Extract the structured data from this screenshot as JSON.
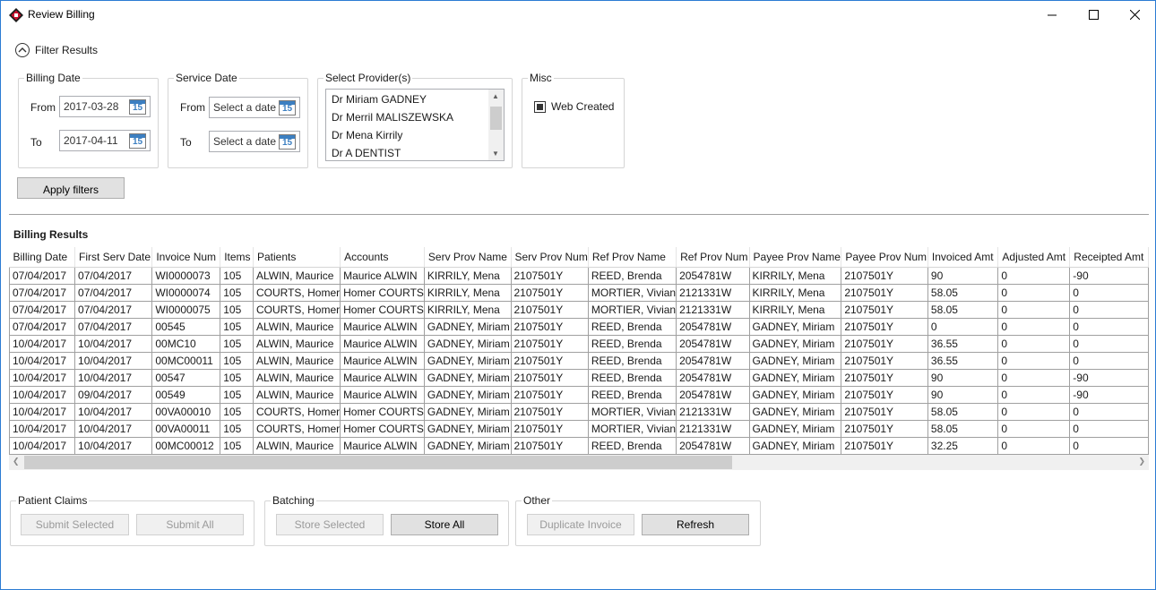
{
  "window": {
    "title": "Review Billing"
  },
  "filter": {
    "toggle_label": "Filter Results",
    "billing_date": {
      "legend": "Billing Date",
      "from_label": "From",
      "from_value": "2017-03-28",
      "to_label": "To",
      "to_value": "2017-04-11"
    },
    "service_date": {
      "legend": "Service Date",
      "from_label": "From",
      "from_placeholder": "Select a date",
      "to_label": "To",
      "to_placeholder": "Select a date"
    },
    "providers": {
      "legend": "Select Provider(s)",
      "items": [
        "Dr Miriam GADNEY",
        "Dr Merril MALISZEWSKA",
        "Dr Mena Kirrily",
        "Dr A DENTIST"
      ]
    },
    "misc": {
      "legend": "Misc",
      "web_created_label": "Web Created",
      "web_created_state": "indeterminate"
    },
    "apply_label": "Apply filters",
    "calendar_icon_text": "15"
  },
  "results": {
    "title": "Billing Results",
    "columns": [
      "Billing Date",
      "First Serv Date",
      "Invoice Num",
      "Items",
      "Patients",
      "Accounts",
      "Serv Prov Name",
      "Serv Prov Num",
      "Ref Prov Name",
      "Ref Prov Num",
      "Payee Prov Name",
      "Payee Prov Num",
      "Invoiced Amt",
      "Adjusted Amt",
      "Receipted Amt"
    ],
    "rows": [
      [
        "07/04/2017",
        "07/04/2017",
        "WI0000073",
        "105",
        "ALWIN, Maurice",
        "Maurice ALWIN",
        "KIRRILY, Mena",
        "2107501Y",
        "REED, Brenda",
        "2054781W",
        "KIRRILY, Mena",
        "2107501Y",
        "90",
        "0",
        "-90"
      ],
      [
        "07/04/2017",
        "07/04/2017",
        "WI0000074",
        "105",
        "COURTS, Homer",
        "Homer COURTS",
        "KIRRILY, Mena",
        "2107501Y",
        "MORTIER, Vivian",
        "2121331W",
        "KIRRILY, Mena",
        "2107501Y",
        "58.05",
        "0",
        "0"
      ],
      [
        "07/04/2017",
        "07/04/2017",
        "WI0000075",
        "105",
        "COURTS, Homer",
        "Homer COURTS",
        "KIRRILY, Mena",
        "2107501Y",
        "MORTIER, Vivian",
        "2121331W",
        "KIRRILY, Mena",
        "2107501Y",
        "58.05",
        "0",
        "0"
      ],
      [
        "07/04/2017",
        "07/04/2017",
        "00545",
        "105",
        "ALWIN, Maurice",
        "Maurice ALWIN",
        "GADNEY, Miriam",
        "2107501Y",
        "REED, Brenda",
        "2054781W",
        "GADNEY, Miriam",
        "2107501Y",
        "0",
        "0",
        "0"
      ],
      [
        "10/04/2017",
        "10/04/2017",
        "00MC10",
        "105",
        "ALWIN, Maurice",
        "Maurice ALWIN",
        "GADNEY, Miriam",
        "2107501Y",
        "REED, Brenda",
        "2054781W",
        "GADNEY, Miriam",
        "2107501Y",
        "36.55",
        "0",
        "0"
      ],
      [
        "10/04/2017",
        "10/04/2017",
        "00MC00011",
        "105",
        "ALWIN, Maurice",
        "Maurice ALWIN",
        "GADNEY, Miriam",
        "2107501Y",
        "REED, Brenda",
        "2054781W",
        "GADNEY, Miriam",
        "2107501Y",
        "36.55",
        "0",
        "0"
      ],
      [
        "10/04/2017",
        "10/04/2017",
        "00547",
        "105",
        "ALWIN, Maurice",
        "Maurice ALWIN",
        "GADNEY, Miriam",
        "2107501Y",
        "REED, Brenda",
        "2054781W",
        "GADNEY, Miriam",
        "2107501Y",
        "90",
        "0",
        "-90"
      ],
      [
        "10/04/2017",
        "09/04/2017",
        "00549",
        "105",
        "ALWIN, Maurice",
        "Maurice ALWIN",
        "GADNEY, Miriam",
        "2107501Y",
        "REED, Brenda",
        "2054781W",
        "GADNEY, Miriam",
        "2107501Y",
        "90",
        "0",
        "-90"
      ],
      [
        "10/04/2017",
        "10/04/2017",
        "00VA00010",
        "105",
        "COURTS, Homer",
        "Homer COURTS",
        "GADNEY, Miriam",
        "2107501Y",
        "MORTIER, Vivian",
        "2121331W",
        "GADNEY, Miriam",
        "2107501Y",
        "58.05",
        "0",
        "0"
      ],
      [
        "10/04/2017",
        "10/04/2017",
        "00VA00011",
        "105",
        "COURTS, Homer",
        "Homer COURTS",
        "GADNEY, Miriam",
        "2107501Y",
        "MORTIER, Vivian",
        "2121331W",
        "GADNEY, Miriam",
        "2107501Y",
        "58.05",
        "0",
        "0"
      ],
      [
        "10/04/2017",
        "10/04/2017",
        "00MC00012",
        "105",
        "ALWIN, Maurice",
        "Maurice ALWIN",
        "GADNEY, Miriam",
        "2107501Y",
        "REED, Brenda",
        "2054781W",
        "GADNEY, Miriam",
        "2107501Y",
        "32.25",
        "0",
        "0"
      ]
    ]
  },
  "actions": {
    "patient_claims": {
      "legend": "Patient Claims",
      "submit_selected": "Submit Selected",
      "submit_all": "Submit All"
    },
    "batching": {
      "legend": "Batching",
      "store_selected": "Store Selected",
      "store_all": "Store All"
    },
    "other": {
      "legend": "Other",
      "duplicate_invoice": "Duplicate Invoice",
      "refresh": "Refresh"
    }
  },
  "colors": {
    "window_border": "#2b7bd3",
    "app_icon": "#c8102e",
    "calendar_accent": "#3c7fc1"
  }
}
